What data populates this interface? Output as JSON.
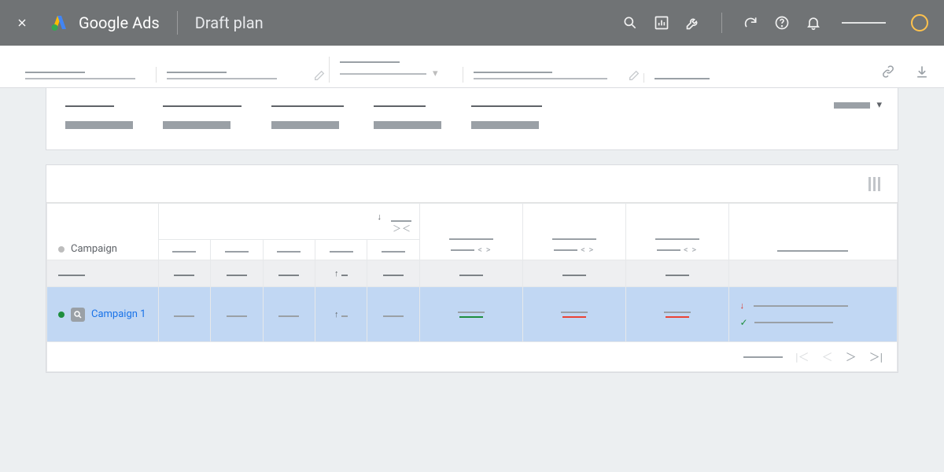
{
  "header": {
    "product": "Google Ads",
    "title": "Draft plan"
  },
  "table": {
    "campaign_header": "Campaign",
    "rows": [
      {
        "name": "Campaign 1"
      }
    ]
  }
}
